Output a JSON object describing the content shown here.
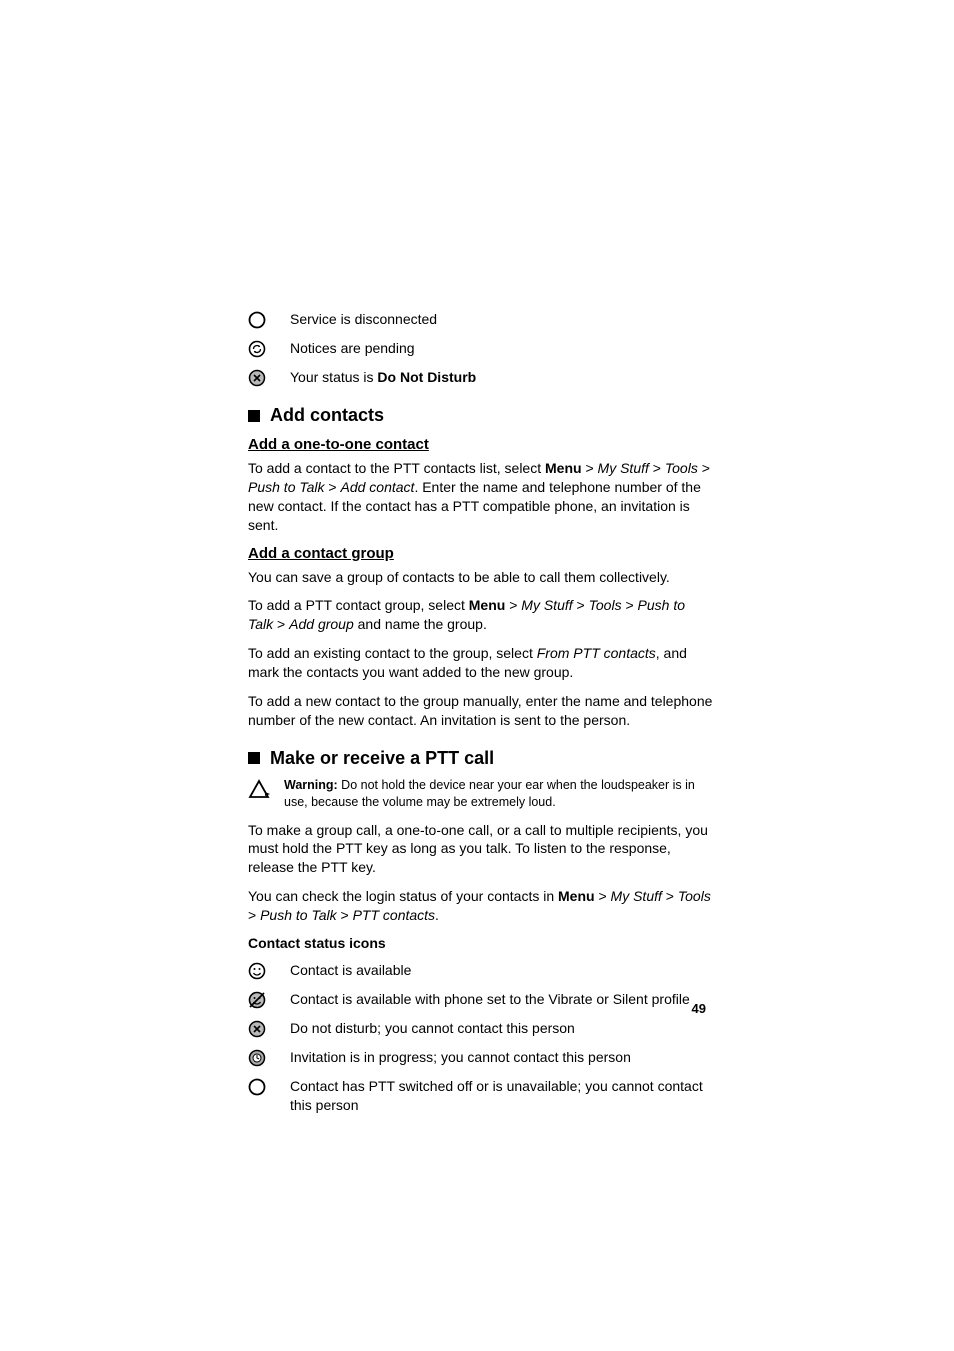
{
  "status_icons": [
    {
      "name": "circle-empty-icon",
      "label": "Service is disconnected"
    },
    {
      "name": "circle-refresh-icon",
      "label": "Notices are pending"
    },
    {
      "name": "circle-x-icon",
      "label_prefix": "Your status is ",
      "label_bold": "Do Not Disturb"
    }
  ],
  "section1": {
    "title": "Add contacts",
    "sub1": {
      "title": "Add a one-to-one contact",
      "p1_a": "To add a contact to the PTT contacts list, select ",
      "p1_menu": "Menu",
      "p1_b": " > ",
      "p1_mystuff": "My Stuff",
      "p1_c": " > ",
      "p1_tools": "Tools",
      "p1_d": " > ",
      "p1_ptt": "Push to Talk",
      "p1_e": " > ",
      "p1_add": "Add contact",
      "p1_f": ". Enter the name and telephone number of the new contact. If the contact has a PTT compatible phone, an invitation is sent."
    },
    "sub2": {
      "title": "Add a contact group",
      "p1": "You can save a group of contacts to be able to call them collectively.",
      "p2_a": "To add a PTT contact group, select ",
      "p2_menu": "Menu",
      "p2_b": " > ",
      "p2_mystuff": "My Stuff",
      "p2_c": " > ",
      "p2_tools": "Tools",
      "p2_d": " > ",
      "p2_ptt": "Push to Talk",
      "p2_e": " > ",
      "p2_add": "Add group",
      "p2_f": " and name the group.",
      "p3_a": "To add an existing contact to the group, select ",
      "p3_from": "From PTT contacts",
      "p3_b": ", and mark the contacts you want added to the new group.",
      "p4": "To add a new contact to the group manually, enter the name and telephone number of the new contact. An invitation is sent to the person."
    }
  },
  "section2": {
    "title": "Make or receive a PTT call",
    "warning_bold": "Warning:",
    "warning_text": " Do not hold the device near your ear when the loudspeaker is in use, because the volume may be extremely loud.",
    "p1": "To make a group call, a one-to-one call, or a call to multiple recipients, you must hold the PTT key as long as you talk. To listen to the response, release the PTT key.",
    "p2_a": "You can check the login status of your contacts in ",
    "p2_menu": "Menu",
    "p2_b": " > ",
    "p2_mystuff": "My Stuff",
    "p2_c": " > ",
    "p2_tools": "Tools",
    "p2_d": " > ",
    "p2_ptt": "Push to Talk",
    "p2_e": " > ",
    "p2_contacts": "PTT contacts",
    "p2_f": ".",
    "subhead": "Contact status icons",
    "contact_icons": [
      {
        "name": "smile-icon",
        "label": "Contact is available"
      },
      {
        "name": "smile-slash-icon",
        "label": "Contact is available with phone set to the Vibrate or Silent profile"
      },
      {
        "name": "circle-x-icon",
        "label": "Do not disturb; you cannot contact this person"
      },
      {
        "name": "circle-clock-icon",
        "label": "Invitation is in progress; you cannot contact this person"
      },
      {
        "name": "circle-empty-icon",
        "label": "Contact has PTT switched off or is unavailable; you cannot contact this person"
      }
    ]
  },
  "page_number": "49"
}
